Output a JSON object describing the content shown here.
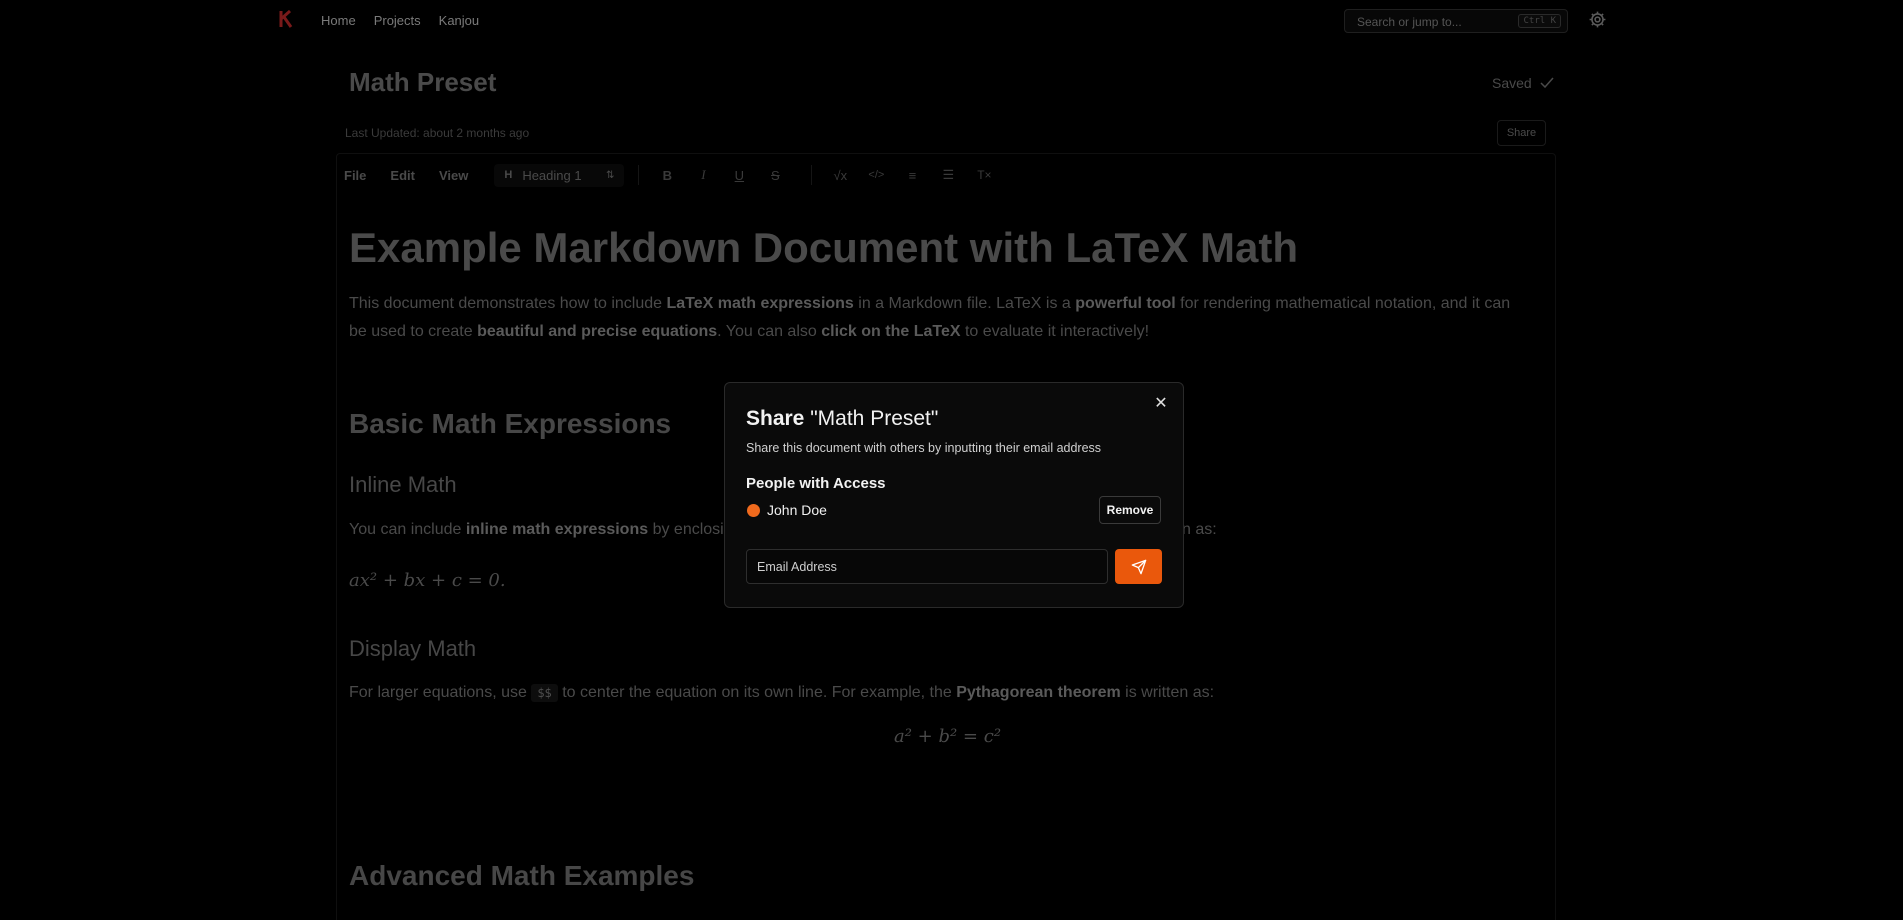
{
  "nav": {
    "logo_icon": "kanjou-logo-icon",
    "links": [
      "Home",
      "Projects",
      "Kanjou"
    ],
    "search_placeholder": "Search or jump to...",
    "search_shortcut": "Ctrl K",
    "settings_icon": "gear-icon"
  },
  "document": {
    "title": "Math Preset",
    "status": "Saved",
    "last_updated": "Last Updated: about 2 months ago",
    "share_label": "Share"
  },
  "toolbar": {
    "menus": [
      "File",
      "Edit",
      "View"
    ],
    "heading_select": "Heading 1",
    "format_icons": [
      "bold-icon",
      "italic-icon",
      "underline-icon",
      "strikethrough-icon",
      "math-icon",
      "code-icon",
      "bullet-list-icon",
      "numbered-list-icon",
      "clear-format-icon"
    ]
  },
  "content": {
    "h1": "Example Markdown Document with LaTeX Math",
    "intro": {
      "t1": "This document demonstrates how to include ",
      "b1": "LaTeX math expressions",
      "t2": " in a Markdown file. LaTeX is a ",
      "b2": "powerful tool",
      "t3": " for rendering mathematical notation, and it can be used to create ",
      "b3": "beautiful and precise equations",
      "t4": ". You can also ",
      "b4": "click on the LaTeX",
      "t5": " to evaluate it interactively!"
    },
    "h2_basic": "Basic Math Expressions",
    "h3_inline": "Inline Math",
    "inline_para": {
      "t1": "You can include ",
      "b1": "inline math expressions",
      "t2": " by enclosi",
      "t3": "n as:"
    },
    "inline_example": "ax² + bx + c = 0.",
    "h3_display": "Display Math",
    "display_para": {
      "t1": "For larger equations, use ",
      "code": "$$",
      "t2": " to center the equation on its own line. For example, the ",
      "b1": "Pythagorean theorem",
      "t3": " is written as:"
    },
    "display_example": "a² + b² = c²",
    "h2_advanced": "Advanced Math Examples"
  },
  "modal": {
    "title_prefix": "Share",
    "title_quoted": "\"Math Preset\"",
    "subtitle": "Share this document with others by inputting their email address",
    "access_heading": "People with Access",
    "people": [
      {
        "name": "John Doe",
        "color": "#f06a1d"
      }
    ],
    "remove_label": "Remove",
    "email_placeholder": "Email Address",
    "send_icon": "send-icon",
    "close_icon": "close-icon"
  },
  "colors": {
    "accent": "#ea580c",
    "background": "#000000"
  }
}
